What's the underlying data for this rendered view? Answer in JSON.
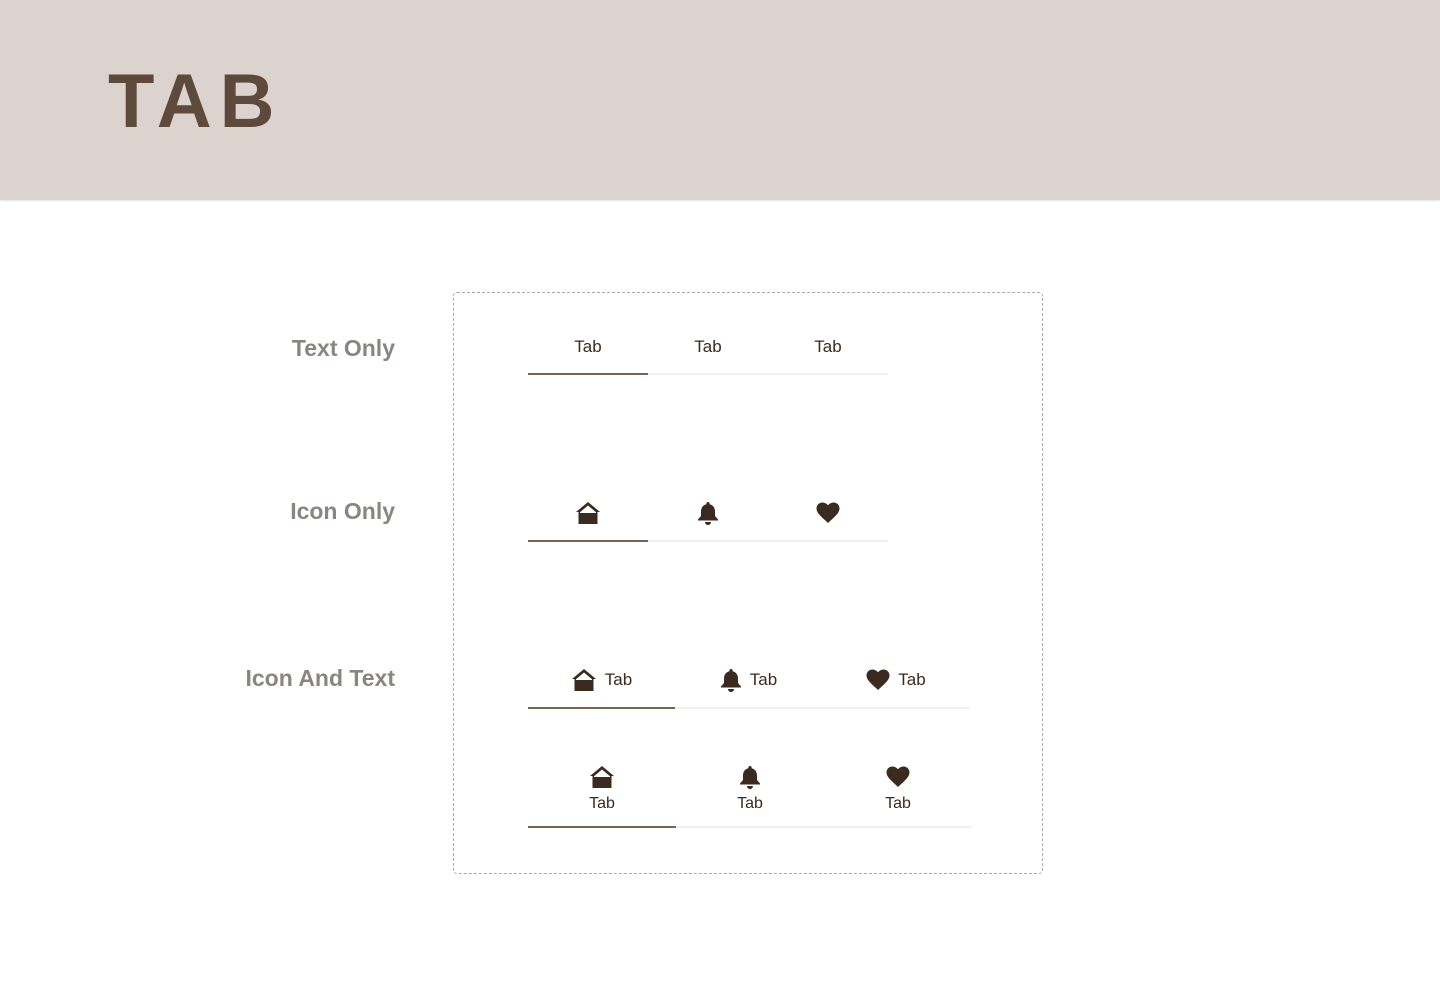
{
  "header": {
    "title": "TAB"
  },
  "rows": {
    "text_only": {
      "label": "Text Only"
    },
    "icon_only": {
      "label": "Icon Only"
    },
    "icon_and_text": {
      "label": "Icon And Text"
    }
  },
  "text_tabs": [
    "Tab",
    "Tab",
    "Tab"
  ],
  "icon_tabs": [
    "home-icon",
    "bell-icon",
    "heart-icon"
  ],
  "inline_tabs": [
    {
      "icon": "home-icon",
      "label": "Tab"
    },
    {
      "icon": "bell-icon",
      "label": "Tab"
    },
    {
      "icon": "heart-icon",
      "label": "Tab"
    }
  ],
  "stacked_tabs": [
    {
      "icon": "home-icon",
      "label": "Tab"
    },
    {
      "icon": "bell-icon",
      "label": "Tab"
    },
    {
      "icon": "heart-icon",
      "label": "Tab"
    }
  ],
  "colors": {
    "header_bg": "#dcd3ce",
    "title": "#5d4a3d",
    "row_label": "#8a8583",
    "tab_text": "#3a2a20",
    "active_indicator": "#7a6253",
    "inactive_line": "#f0f0f0"
  }
}
